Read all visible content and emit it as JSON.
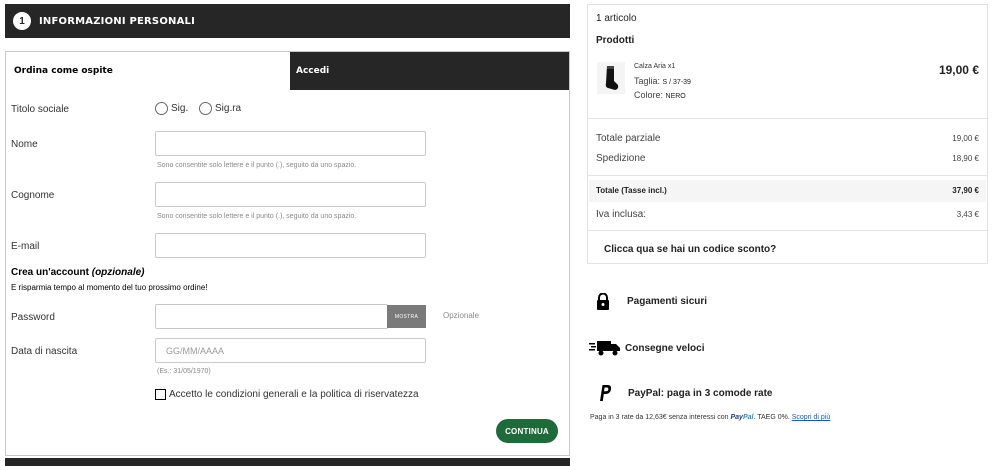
{
  "checkout": {
    "step": {
      "number": "1",
      "title": "INFORMAZIONI PERSONALI"
    },
    "tabs": {
      "guest": "Ordina come ospite",
      "login": "Accedi"
    },
    "form": {
      "title_label": "Titolo sociale",
      "title_options": [
        "Sig.",
        "Sig.ra"
      ],
      "first_name_label": "Nome",
      "name_hint": "Sono consentite solo lettere e il punto (.), seguito da uno spazio.",
      "last_name_label": "Cognome",
      "last_name_hint": "Sono consentite solo lettere e il punto (.), seguito da uno spazio.",
      "email_label": "E-mail",
      "account_title": "Crea un'account",
      "account_optional": "(opzionale)",
      "account_subtitle": "E risparmia tempo al momento del tuo prossimo ordine!",
      "password_label": "Password",
      "show_button": "MOSTRA",
      "password_optional": "Opzionale",
      "birthdate_label": "Data di nascita",
      "birthdate_placeholder": "GG/MM/AAAA",
      "birthdate_hint": "(Es.: 31/05/1970)",
      "terms_label": "Accetto le condizioni generali e la politica di riservatezza",
      "continue_button": "CONTINUA"
    }
  },
  "cart": {
    "items_count": "1 articolo",
    "products_heading": "Prodotti",
    "product": {
      "name": "Calza Aria x1",
      "size_label": "Taglia:",
      "size_value": "S / 37-39",
      "color_label": "Colore:",
      "color_value": "NERO",
      "price": "19,00 €"
    },
    "subtotal_label": "Totale parziale",
    "subtotal_value": "19,00 €",
    "shipping_label": "Spedizione",
    "shipping_value": "18,90 €",
    "total_label": "Totale (Tasse incl.)",
    "total_value": "37,90 €",
    "vat_label": "Iva inclusa:",
    "vat_value": "3,43 €",
    "discount_link": "Clicca qua se hai un codice sconto?"
  },
  "benefits": {
    "secure": "Pagamenti sicuri",
    "fast": "Consegne veloci",
    "paypal": "PayPal: paga in 3 comode rate"
  },
  "paypal_note": {
    "text": "Paga in 3 rate da 12,63€ senza interessi con",
    "brand_a": "Pay",
    "brand_b": "Pal",
    "rate": ". TAEG 0%.",
    "link": "Scopri di più"
  },
  "colors": {
    "dark": "#262626",
    "accent_green": "#1e6b3a",
    "paypal_blue": "#1a3d8f"
  }
}
